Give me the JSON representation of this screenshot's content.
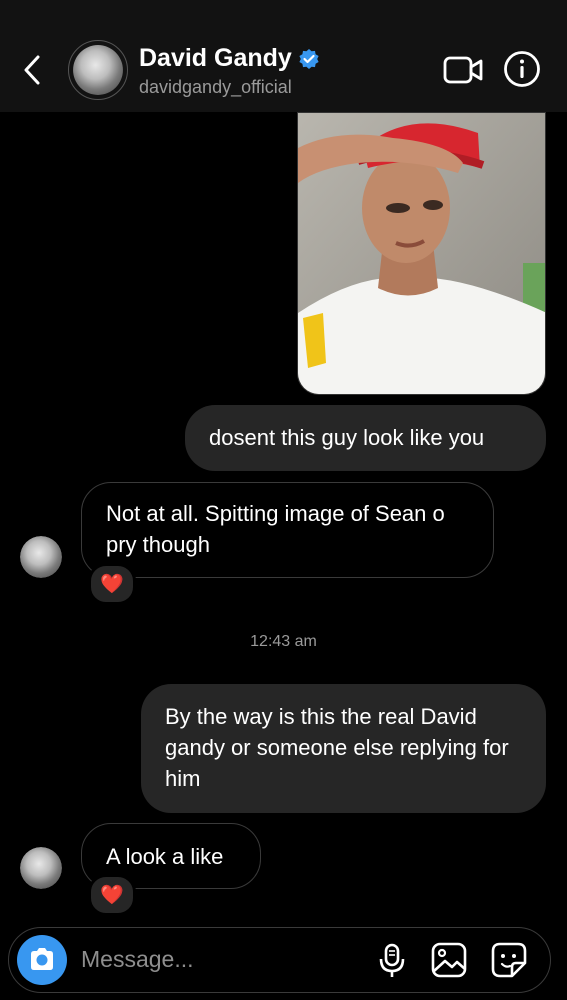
{
  "header": {
    "name": "David Gandy",
    "handle": "davidgandy_official"
  },
  "messages": [
    {
      "from": "me",
      "type": "image",
      "description": "shared-photo"
    },
    {
      "from": "me",
      "text": "dosent this guy look like you"
    },
    {
      "from": "them",
      "text": "Not at all. Spitting image of Sean o pry though",
      "reaction": "❤️"
    },
    {
      "from": "me",
      "text": "By the way is this the real David gandy or someone else replying for him"
    },
    {
      "from": "them",
      "text": "A look a like",
      "reaction": "❤️"
    }
  ],
  "timestamp": "12:43 am",
  "composer": {
    "placeholder": "Message..."
  },
  "colors": {
    "accent": "#3897f0",
    "header_bg": "#121212",
    "outgoing_bubble": "#262626",
    "verified": "#3897f0"
  },
  "icons": [
    "back-arrow-icon",
    "video-call-icon",
    "info-icon",
    "verified-badge-icon",
    "camera-icon",
    "microphone-icon",
    "gallery-icon",
    "sticker-icon",
    "heart-reaction-icon"
  ]
}
